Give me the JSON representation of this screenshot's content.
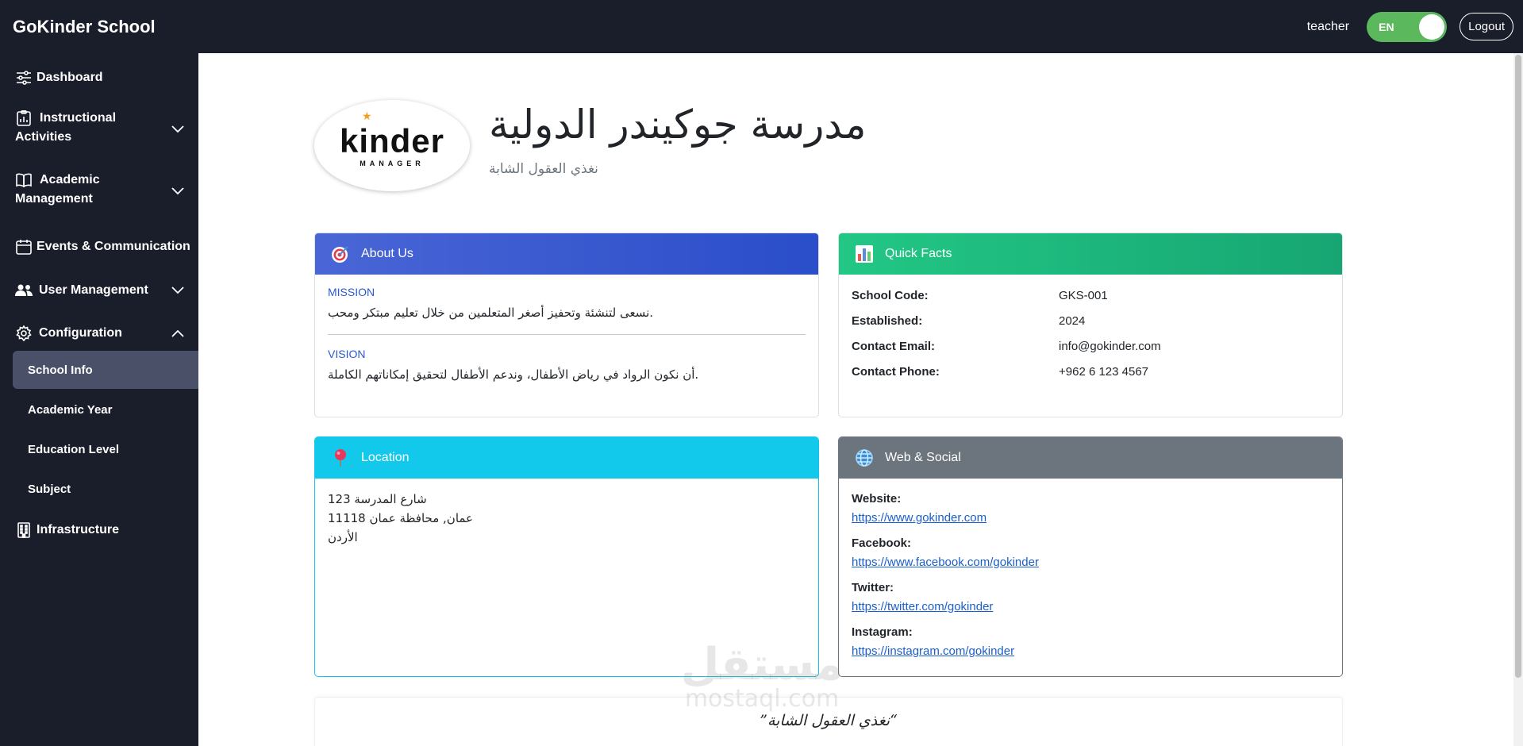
{
  "topbar": {
    "brand": "GoKinder School",
    "role": "teacher",
    "lang": "EN",
    "logout": "Logout"
  },
  "sidebar": {
    "items": [
      {
        "label": "Dashboard",
        "icon": "sliders-icon"
      },
      {
        "label_line1": "Instructional",
        "label_line2": "Activities",
        "icon": "clipboard-chart-icon"
      },
      {
        "label_line1": "Academic",
        "label_line2": "Management",
        "icon": "book-icon"
      },
      {
        "label": "Events & Communication",
        "icon": "calendar-icon"
      },
      {
        "label": "User Management",
        "icon": "users-icon"
      },
      {
        "label": "Configuration",
        "icon": "gear-icon"
      },
      {
        "label": "Infrastructure",
        "icon": "building-icon"
      }
    ],
    "config_subitems": [
      "School Info",
      "Academic Year",
      "Education Level",
      "Subject"
    ]
  },
  "header": {
    "logo_word": "kinder",
    "logo_sub": "MANAGER",
    "school_name": "مدرسة جوكيندر الدولية",
    "tagline": "نغذي العقول الشابة"
  },
  "about": {
    "title": "About Us",
    "mission_label": "MISSION",
    "mission_text": "نسعى لتنشئة وتحفيز أصغر المتعلمين من خلال تعليم مبتكر ومحب.",
    "vision_label": "VISION",
    "vision_text": "أن نكون الرواد في رياض الأطفال، وندعم الأطفال لتحقيق إمكاناتهم الكاملة."
  },
  "facts": {
    "title": "Quick Facts",
    "rows": [
      {
        "key": "School Code:",
        "value": "GKS-001"
      },
      {
        "key": "Established:",
        "value": "2024"
      },
      {
        "key": "Contact Email:",
        "value": "info@gokinder.com"
      },
      {
        "key": "Contact Phone:",
        "value": "+962 6 123 4567"
      }
    ]
  },
  "location": {
    "title": "Location",
    "lines": [
      "شارع المدرسة 123",
      "عمان, محافظة عمان 11118",
      "الأردن"
    ]
  },
  "web": {
    "title": "Web & Social",
    "links": [
      {
        "label": "Website:",
        "url": "https://www.gokinder.com"
      },
      {
        "label": "Facebook:",
        "url": "https://www.facebook.com/gokinder"
      },
      {
        "label": "Twitter:",
        "url": "https://twitter.com/gokinder"
      },
      {
        "label": "Instagram:",
        "url": "https://instagram.com/gokinder"
      }
    ]
  },
  "quote": "”نغذي العقول الشابة“",
  "watermark": {
    "ar": "مستقل",
    "en": "mostaql.com"
  },
  "colors": {
    "sidebar_bg": "#1a1d2a",
    "active_item": "#4a5068",
    "about_header": "#3a5bd0",
    "facts_header": "#1fbf80",
    "location_header": "#12c9ec",
    "web_header": "#6c757d",
    "toggle": "#5cb85c"
  }
}
